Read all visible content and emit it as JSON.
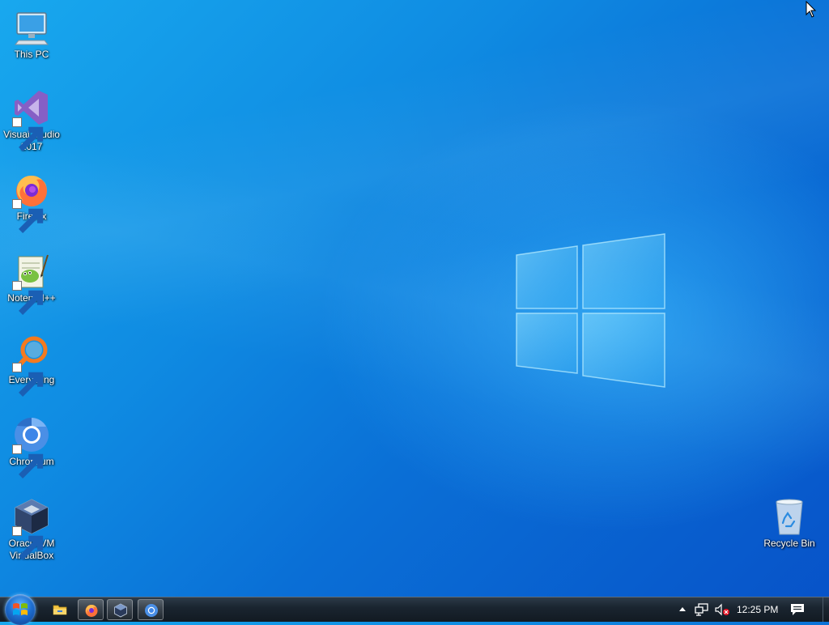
{
  "desktop": {
    "icons": [
      {
        "label": "This PC",
        "icon": "computer-icon"
      },
      {
        "label": "Visual Studio 2017",
        "icon": "visual-studio-icon"
      },
      {
        "label": "Firefox",
        "icon": "firefox-icon"
      },
      {
        "label": "Notepad++",
        "icon": "notepad-plus-plus-icon"
      },
      {
        "label": "Everything",
        "icon": "everything-search-icon"
      },
      {
        "label": "Chromium",
        "icon": "chromium-icon"
      },
      {
        "label": "Oracle VM VirtualBox",
        "icon": "virtualbox-icon"
      },
      {
        "label": "Recycle Bin",
        "icon": "recycle-bin-icon"
      }
    ]
  },
  "taskbar": {
    "start_icon": "windows-start-icon",
    "pinned": [
      {
        "name": "File Explorer",
        "icon": "folder-icon"
      },
      {
        "name": "Firefox",
        "icon": "firefox-icon"
      },
      {
        "name": "Oracle VM VirtualBox",
        "icon": "virtualbox-icon"
      },
      {
        "name": "Chromium",
        "icon": "chromium-icon"
      }
    ],
    "tray": {
      "icons": [
        "show-hidden-icons-icon",
        "network-icon",
        "volume-muted-icon"
      ],
      "time": "12:25 PM",
      "action_center_icon": "action-center-icon"
    }
  },
  "colors": {
    "wallpaper_light": "#18a8ee",
    "wallpaper_dark": "#0752c8",
    "taskbar": "#1a2530"
  }
}
